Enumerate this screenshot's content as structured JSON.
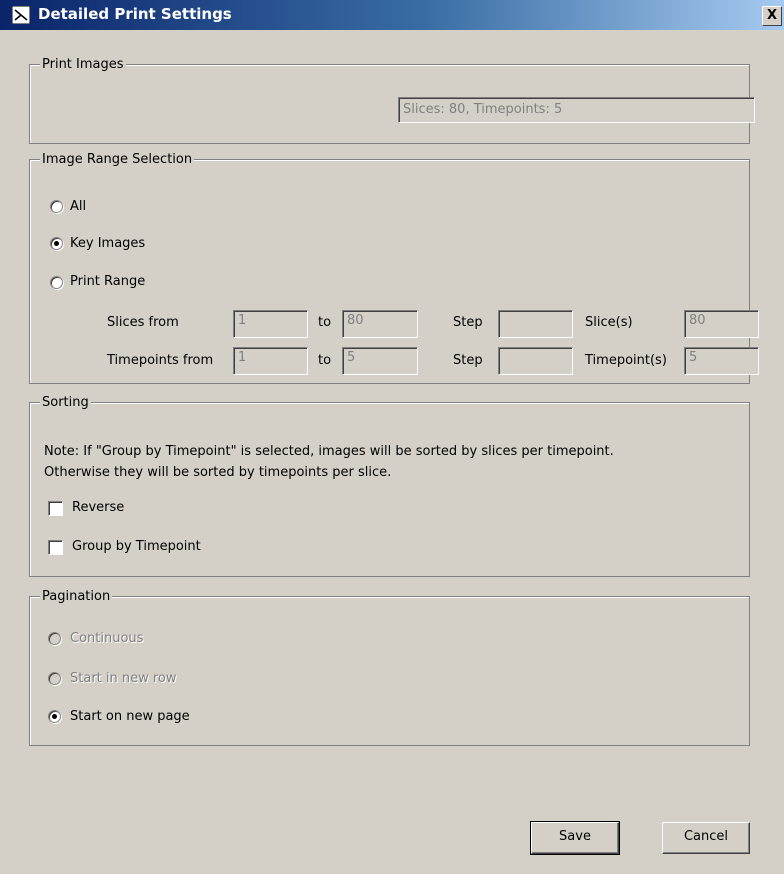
{
  "window": {
    "title": "Detailed Print Settings",
    "close_label": "X"
  },
  "print_images": {
    "legend": "Print Images",
    "summary_value": "Slices: 80, Timepoints: 5"
  },
  "image_range": {
    "legend": "Image Range Selection",
    "options": [
      {
        "label": "All",
        "selected": false
      },
      {
        "label": "Key Images",
        "selected": true
      },
      {
        "label": "Print Range",
        "selected": false
      }
    ],
    "slices": {
      "label": "Slices from",
      "from": "1",
      "to_label": "to",
      "to": "80",
      "step_label": "Step",
      "step": "",
      "count_label": "Slice(s)",
      "count": "80"
    },
    "timepoints": {
      "label": "Timepoints from",
      "from": "1",
      "to_label": "to",
      "to": "5",
      "step_label": "Step",
      "step": "",
      "count_label": "Timepoint(s)",
      "count": "5"
    }
  },
  "sorting": {
    "legend": "Sorting",
    "note_line1": "Note: If \"Group by Timepoint\" is selected, images will be sorted by slices per timepoint.",
    "note_line2": "Otherwise they will be sorted by timepoints per slice.",
    "reverse_label": "Reverse",
    "group_label": "Group by Timepoint"
  },
  "pagination": {
    "legend": "Pagination",
    "options": [
      {
        "label": "Continuous",
        "selected": false,
        "enabled": false
      },
      {
        "label": "Start in new row",
        "selected": false,
        "enabled": false
      },
      {
        "label": "Start on new page",
        "selected": true,
        "enabled": true
      }
    ]
  },
  "buttons": {
    "save": "Save",
    "cancel": "Cancel"
  }
}
